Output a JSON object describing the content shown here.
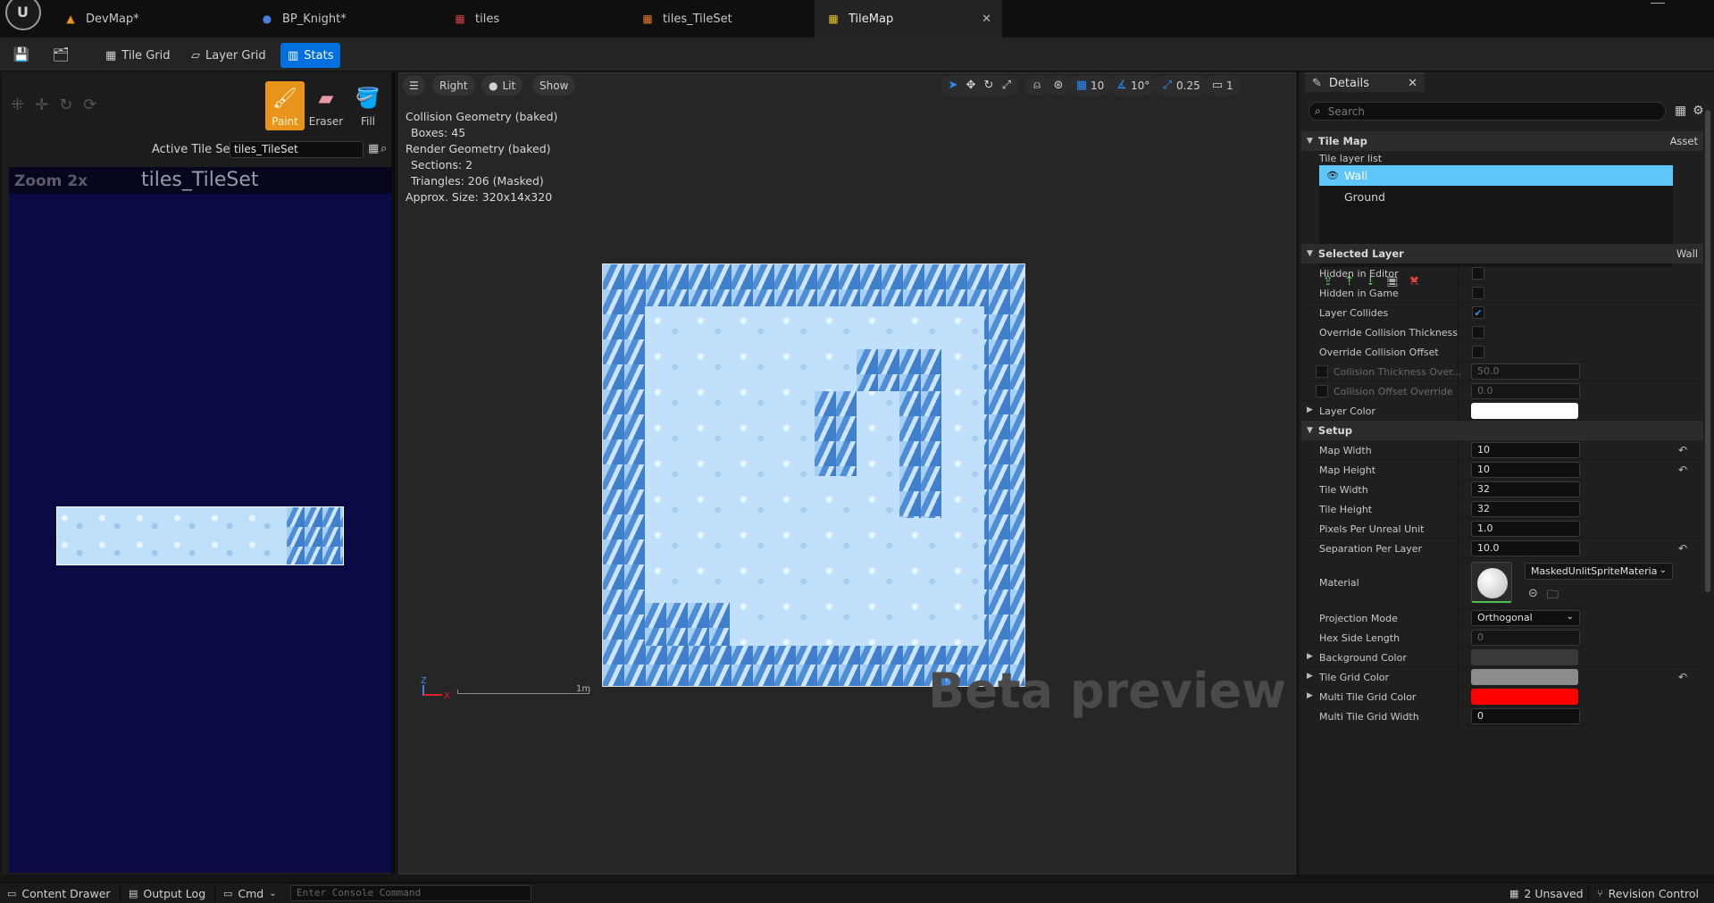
{
  "tabs": [
    {
      "label": "DevMap*",
      "icon": "map-icon",
      "active": false
    },
    {
      "label": "BP_Knight*",
      "icon": "blueprint-icon",
      "active": false
    },
    {
      "label": "tiles",
      "icon": "texture-icon",
      "active": false
    },
    {
      "label": "tiles_TileSet",
      "icon": "tileset-icon",
      "active": false
    },
    {
      "label": "TileMap",
      "icon": "tilemap-icon",
      "active": true
    }
  ],
  "toolbar": {
    "tile_grid": "Tile Grid",
    "layer_grid": "Layer Grid",
    "stats": "Stats"
  },
  "left_panel": {
    "tools": [
      "Paint",
      "Eraser",
      "Fill"
    ],
    "active_tile_set_label": "Active Tile Set",
    "active_tile_set_value": "tiles_TileSet",
    "zoom_label": "Zoom 2x",
    "tileset_title": "tiles_TileSet"
  },
  "viewport": {
    "view_mode": "Right",
    "lighting": "Lit",
    "show": "Show",
    "grid_snap": "10",
    "rotation_snap": "10°",
    "scale_snap": "0.25",
    "camera_speed": "1",
    "stats": [
      {
        "text": "Collision Geometry (baked)",
        "indent": false
      },
      {
        "text": "Boxes: 45",
        "indent": true
      },
      {
        "text": "Render Geometry (baked)",
        "indent": false
      },
      {
        "text": "Sections: 2",
        "indent": true
      },
      {
        "text": "Triangles: 206 (Masked)",
        "indent": true
      },
      {
        "text": "Approx. Size: 320x14x320",
        "indent": false
      }
    ],
    "axis_z": "Z",
    "axis_x": "X",
    "scale_label": "1m",
    "watermark": "Beta preview"
  },
  "details": {
    "tab_label": "Details",
    "search_placeholder": "Search",
    "tile_map_section": "Tile Map",
    "tile_map_section_right": "Asset",
    "tile_layer_list_label": "Tile layer list",
    "layers": [
      {
        "name": "Wall",
        "selected": true
      },
      {
        "name": "Ground",
        "selected": false
      }
    ],
    "selected_layer_section": "Selected Layer",
    "selected_layer_name": "Wall",
    "layer_props": [
      {
        "label": "Hidden in Editor",
        "checked": false
      },
      {
        "label": "Hidden in Game",
        "checked": false
      },
      {
        "label": "Layer Collides",
        "checked": true
      },
      {
        "label": "Override Collision Thickness",
        "checked": false
      },
      {
        "label": "Override Collision Offset",
        "checked": false
      }
    ],
    "collision_thickness_label": "Collision Thickness Over...",
    "collision_thickness_value": "50.0",
    "collision_offset_label": "Collision Offset Override",
    "collision_offset_value": "0.0",
    "layer_color_label": "Layer Color",
    "layer_color": "#ffffff",
    "setup_section": "Setup",
    "map_width_label": "Map Width",
    "map_width": "10",
    "map_height_label": "Map Height",
    "map_height": "10",
    "tile_width_label": "Tile Width",
    "tile_width": "32",
    "tile_height_label": "Tile Height",
    "tile_height": "32",
    "ppu_label": "Pixels Per Unreal Unit",
    "ppu": "1.0",
    "sep_label": "Separation Per Layer",
    "sep": "10.0",
    "material_label": "Material",
    "material_value": "MaskedUnlitSpriteMateria",
    "projection_label": "Projection Mode",
    "projection_value": "Orthogonal",
    "hex_label": "Hex Side Length",
    "hex_value": "0",
    "bg_color_label": "Background Color",
    "bg_color": "#3a3a3a",
    "tile_grid_color_label": "Tile Grid Color",
    "tile_grid_color": "#8c8c8c",
    "multi_grid_color_label": "Multi Tile Grid Color",
    "multi_grid_color": "#ff0000",
    "multi_grid_width_label": "Multi Tile Grid Width",
    "multi_grid_width": "0"
  },
  "statusbar": {
    "content_drawer": "Content Drawer",
    "output_log": "Output Log",
    "cmd": "Cmd",
    "console_placeholder": "Enter Console Command",
    "unsaved": "2 Unsaved",
    "revision_control": "Revision Control"
  }
}
